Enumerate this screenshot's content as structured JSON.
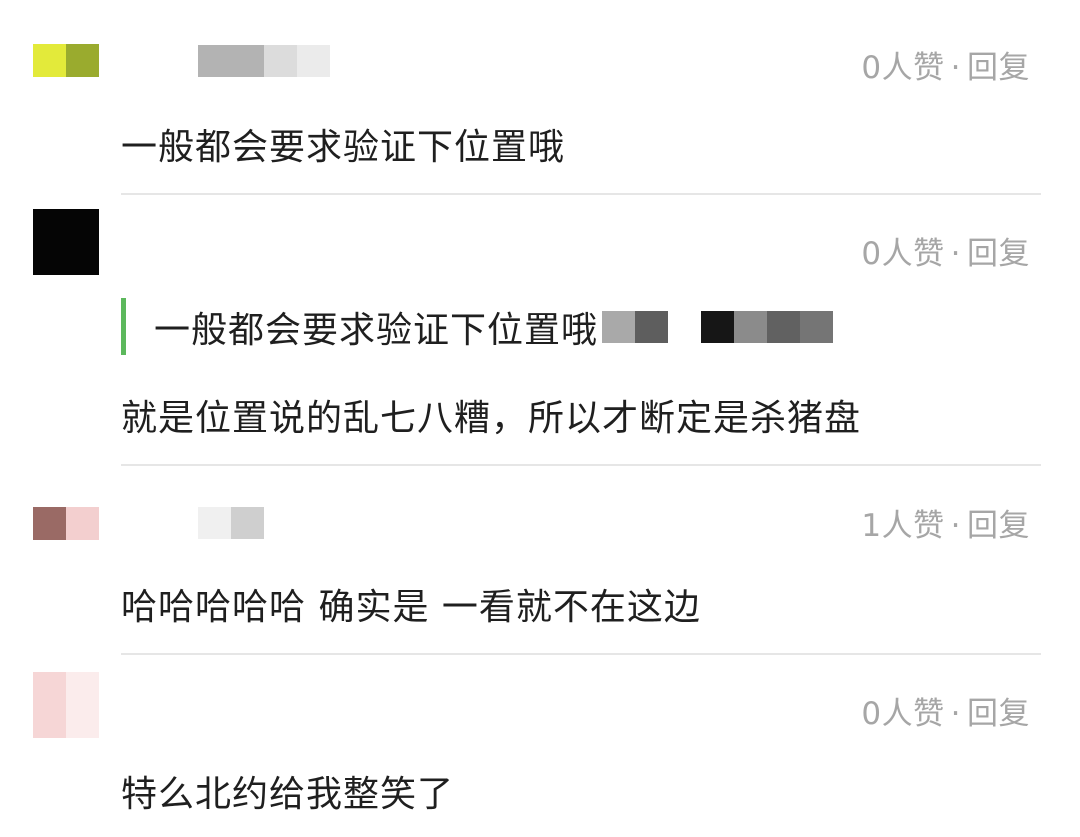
{
  "comments": [
    {
      "likes": "0人赞",
      "sep": "·",
      "reply": "回复",
      "text": "一般都会要求验证下位置哦",
      "avatar_colors": [
        "#e3ea3a",
        "#9aab2e"
      ],
      "name_colors": [
        "#b3b3b3",
        "#dcdcdc",
        "#ebebeb"
      ]
    },
    {
      "likes": "0人赞",
      "sep": "·",
      "reply": "回复",
      "quote": "一般都会要求验证下位置哦",
      "text": "就是位置说的乱七八糟，所以才断定是杀猪盘",
      "avatar_colors": [
        "#050505",
        "#0d0d0d"
      ],
      "quote_blur_colors": [
        "#a9a9a9",
        "#5e5e5e",
        "#ffffff",
        "#161616",
        "#8b8b8b",
        "#616161",
        "#757575"
      ]
    },
    {
      "likes": "1人赞",
      "sep": "·",
      "reply": "回复",
      "text": "哈哈哈哈哈 确实是 一看就不在这边",
      "avatar_colors": [
        "#9a6a65",
        "#f3cfcf"
      ],
      "name_colors": [
        "#f0f0f0",
        "#cfcfcf"
      ]
    },
    {
      "likes": "0人赞",
      "sep": "·",
      "reply": "回复",
      "text": "特么北约给我整笑了",
      "avatar_colors": [
        "#f6d6d6",
        "#fbecec"
      ]
    }
  ],
  "accent_color": "#5cb85c"
}
